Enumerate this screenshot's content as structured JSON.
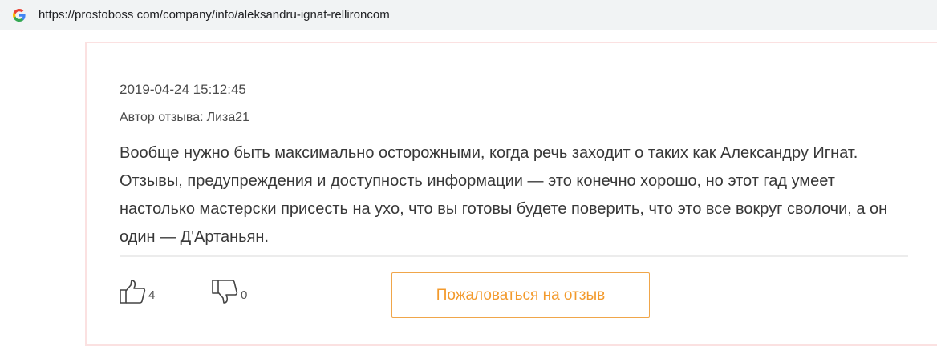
{
  "browser": {
    "url": "https://prostoboss com/company/info/aleksandru-ignat-rellironcom",
    "favicon_icon": "google-g-icon"
  },
  "review": {
    "date": "2019-04-24 15:12:45",
    "author_label": "Автор отзыва:",
    "author_name": "Лиза21",
    "text": "Вообще нужно быть максимально осторожными, когда речь заходит о таких как Александру Игнат. Отзывы, предупреждения и доступность информации — это конечно хорошо, но этот гад умеет настолько мастерски присесть на ухо, что вы готовы будете поверить, что это все вокруг сволочи, а он один — Д'Артаньян."
  },
  "actions": {
    "likes_count": "4",
    "dislikes_count": "0",
    "like_icon": "thumbs-up-icon",
    "dislike_icon": "thumbs-down-icon",
    "complain_label": "Пожаловаться на отзыв"
  },
  "colors": {
    "accent": "#f39a2c",
    "card_border": "#fbe1e1"
  }
}
